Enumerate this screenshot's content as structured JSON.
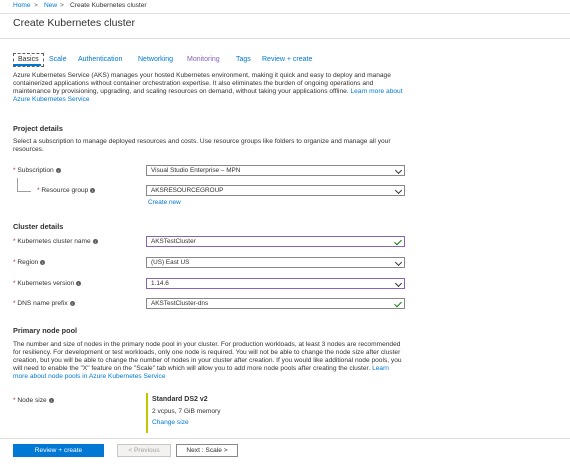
{
  "breadcrumb": {
    "home": "Home",
    "new": "New",
    "current": "Create Kubernetes cluster",
    "separator": ">"
  },
  "page": {
    "title": "Create Kubernetes cluster"
  },
  "tabs": [
    {
      "label": "Basics",
      "active": true
    },
    {
      "label": "Scale"
    },
    {
      "label": "Authentication"
    },
    {
      "label": "Networking"
    },
    {
      "label": "Monitoring"
    },
    {
      "label": "Tags"
    },
    {
      "label": "Review + create"
    }
  ],
  "intro": {
    "text": "Azure Kubernetes Service (AKS) manages your hosted Kubernetes environment, making it quick and easy to deploy and manage containerized applications without container orchestration expertise. It also eliminates the burden of ongoing operations and maintenance by provisioning, upgrading, and scaling resources on demand, without taking your applications offline.",
    "link": "Learn more about Azure Kubernetes Service"
  },
  "project": {
    "heading": "Project details",
    "description": "Select a subscription to manage deployed resources and costs. Use resource groups like folders to organize and manage all your resources.",
    "subscription_label": "Subscription",
    "subscription_value": "Visual Studio Enterprise – MPN",
    "resource_group_label": "Resource group",
    "resource_group_value": "AKSRESOURCEGROUP",
    "create_new": "Create new"
  },
  "cluster": {
    "heading": "Cluster details",
    "name_label": "Kubernetes cluster name",
    "name_value": "AKSTestCluster",
    "region_label": "Region",
    "region_value": "(US) East US",
    "version_label": "Kubernetes version",
    "version_value": "1.14.6",
    "dns_label": "DNS name prefix",
    "dns_value": "AKSTestCluster-dns"
  },
  "node_pool": {
    "heading": "Primary node pool",
    "description": "The number and size of nodes in the primary node pool in your cluster. For production workloads, at least 3 nodes are recommended for resiliency. For development or test workloads, only one node is required. You will not be able to change the node size after cluster creation, but you will be able to change the number of nodes in your cluster after creation. If you would like additional node pools, you will need to enable the \"X\" feature on the \"Scale\" tab which will allow you to add more node pools after creating the cluster.",
    "link": "Learn more about node pools in Azure Kubernetes Service",
    "size_label": "Node size",
    "size_name": "Standard DS2 v2",
    "size_specs": "2 vcpus, 7 GiB memory",
    "change_size": "Change size"
  },
  "footer": {
    "review_button": "Review + create",
    "previous_button": "< Previous",
    "next_button": "Next : Scale >"
  },
  "colors": {
    "accent": "#0078d4",
    "required": "#a4262c",
    "success": "#107c10",
    "focus": "#8764b8"
  }
}
